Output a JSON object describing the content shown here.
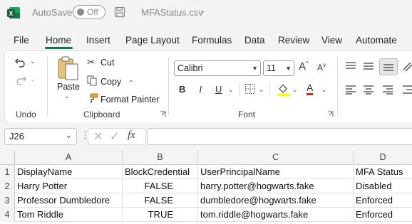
{
  "titlebar": {
    "app_icon": "excel-logo-icon",
    "autosave_label": "AutoSave",
    "autosave_state": "Off",
    "filename": "MFAStatus.csv"
  },
  "menu": {
    "tabs": [
      "File",
      "Home",
      "Insert",
      "Page Layout",
      "Formulas",
      "Data",
      "Review",
      "View",
      "Automate"
    ],
    "active": "Home"
  },
  "ribbon": {
    "undo_group": {
      "label": "Undo"
    },
    "clipboard": {
      "label": "Clipboard",
      "paste": "Paste",
      "cut": "Cut",
      "copy": "Copy",
      "format_painter": "Format Painter"
    },
    "font": {
      "label": "Font",
      "font_name": "Calibri",
      "font_size": "11",
      "bold": "B",
      "italic": "I",
      "underline": "U",
      "font_color_glyph": "A",
      "highlight_color": "#ffff00",
      "font_color": "#e02020"
    }
  },
  "formula_bar": {
    "name_box": "J26",
    "fx": "fx",
    "formula": ""
  },
  "sheet": {
    "columns": [
      "A",
      "B",
      "C",
      "D"
    ],
    "rows": [
      {
        "num": "1",
        "cells": [
          "DisplayName",
          "BlockCredential",
          "UserPrincipalName",
          "MFA Status"
        ]
      },
      {
        "num": "2",
        "cells": [
          "Harry Potter",
          "FALSE",
          "harry.potter@hogwarts.fake",
          "Disabled"
        ]
      },
      {
        "num": "3",
        "cells": [
          "Professor Dumbledore",
          "FALSE",
          "dumbledore@hogwarts.fake",
          "Enforced"
        ]
      },
      {
        "num": "4",
        "cells": [
          "Tom Riddle",
          "TRUE",
          "tom.riddle@hogwarts.fake",
          "Enforced"
        ]
      }
    ]
  },
  "colors": {
    "accent": "#1e7145",
    "excel_green": "#107c41"
  }
}
